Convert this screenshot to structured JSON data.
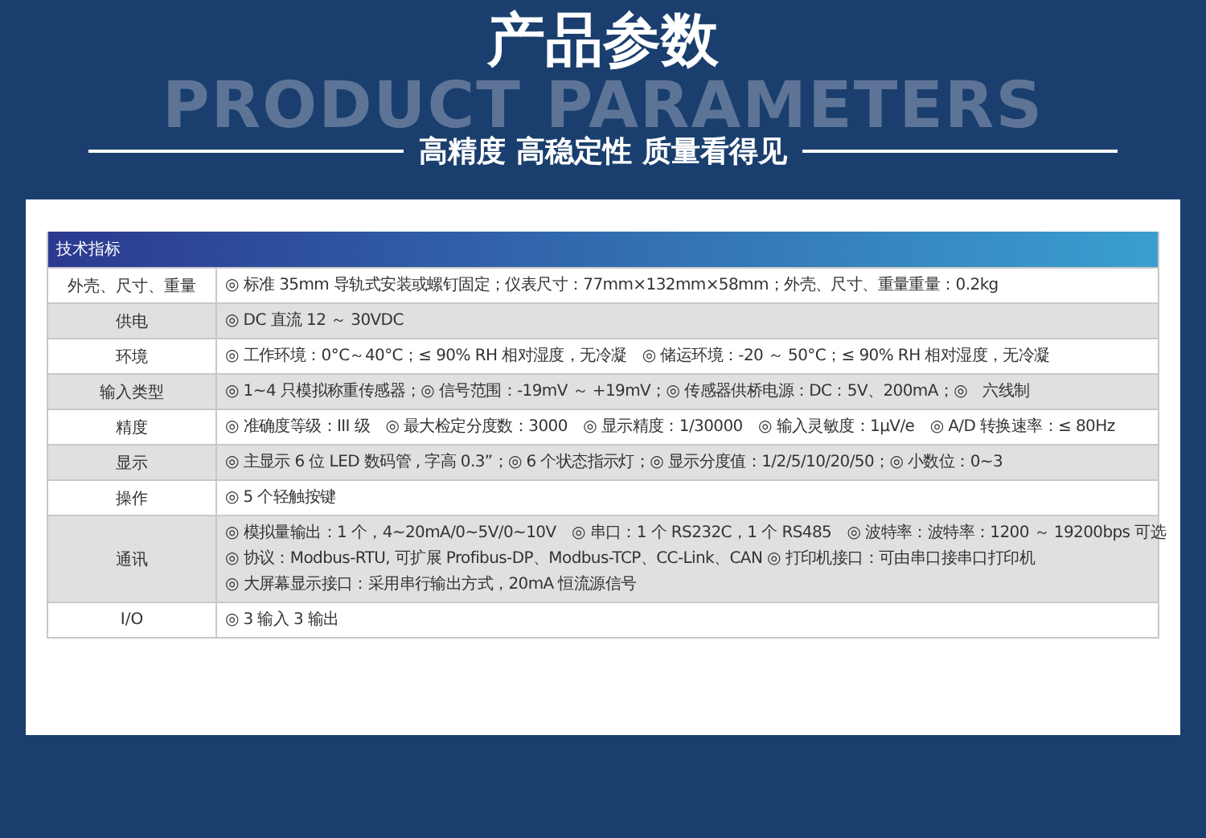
{
  "banner": {
    "title": "产品参数",
    "subtitle_en": "PRODUCT PARAMETERS",
    "tagline": "高精度 高稳定性 质量看得见"
  },
  "table": {
    "title": "技术指标",
    "rows": [
      {
        "label": "外壳、尺寸、重量",
        "shaded": false,
        "lines": [
          "◎ 标准 35mm 导轨式安装或螺钉固定；仪表尺寸：77mm×132mm×58mm；外壳、尺寸、重量重量：0.2kg"
        ]
      },
      {
        "label": "供电",
        "shaded": true,
        "lines": [
          "◎ DC 直流 12 ～ 30VDC"
        ]
      },
      {
        "label": "环境",
        "shaded": false,
        "lines": [
          "◎ 工作环境：0°C～40°C；≤ 90% RH 相对湿度，无冷凝　◎ 储运环境：-20 ～ 50°C；≤ 90% RH 相对湿度，无冷凝"
        ]
      },
      {
        "label": "输入类型",
        "shaded": true,
        "lines": [
          "◎ 1~4 只模拟称重传感器；◎ 信号范围：-19mV ～ +19mV；◎ 传感器供桥电源：DC：5V、200mA；◎　六线制"
        ]
      },
      {
        "label": "精度",
        "shaded": false,
        "lines": [
          "◎ 准确度等级：III 级　◎ 最大检定分度数：3000　◎ 显示精度：1/30000　◎ 输入灵敏度：1μV/e　◎ A/D 转换速率：≤ 80Hz"
        ]
      },
      {
        "label": "显示",
        "shaded": true,
        "lines": [
          "◎ 主显示 6 位 LED 数码管 , 字高 0.3”；◎ 6 个状态指示灯；◎ 显示分度值：1/2/5/10/20/50；◎ 小数位：0~3"
        ]
      },
      {
        "label": "操作",
        "shaded": false,
        "lines": [
          "◎ 5 个轻触按键"
        ]
      },
      {
        "label": "通讯",
        "shaded": true,
        "lines": [
          "◎ 模拟量输出：1 个，4~20mA/0~5V/0~10V　◎ 串口：1 个 RS232C，1 个 RS485　◎ 波特率：波特率：1200 ～ 19200bps 可选",
          "◎ 协议：Modbus-RTU, 可扩展 Profibus-DP、Modbus-TCP、CC-Link、CAN ◎ 打印机接口：可由串口接串口打印机",
          "◎ 大屏幕显示接口：采用串行输出方式，20mA 恒流源信号"
        ]
      },
      {
        "label": "I/O",
        "shaded": false,
        "lines": [
          "◎ 3 输入 3 输出"
        ]
      }
    ]
  }
}
